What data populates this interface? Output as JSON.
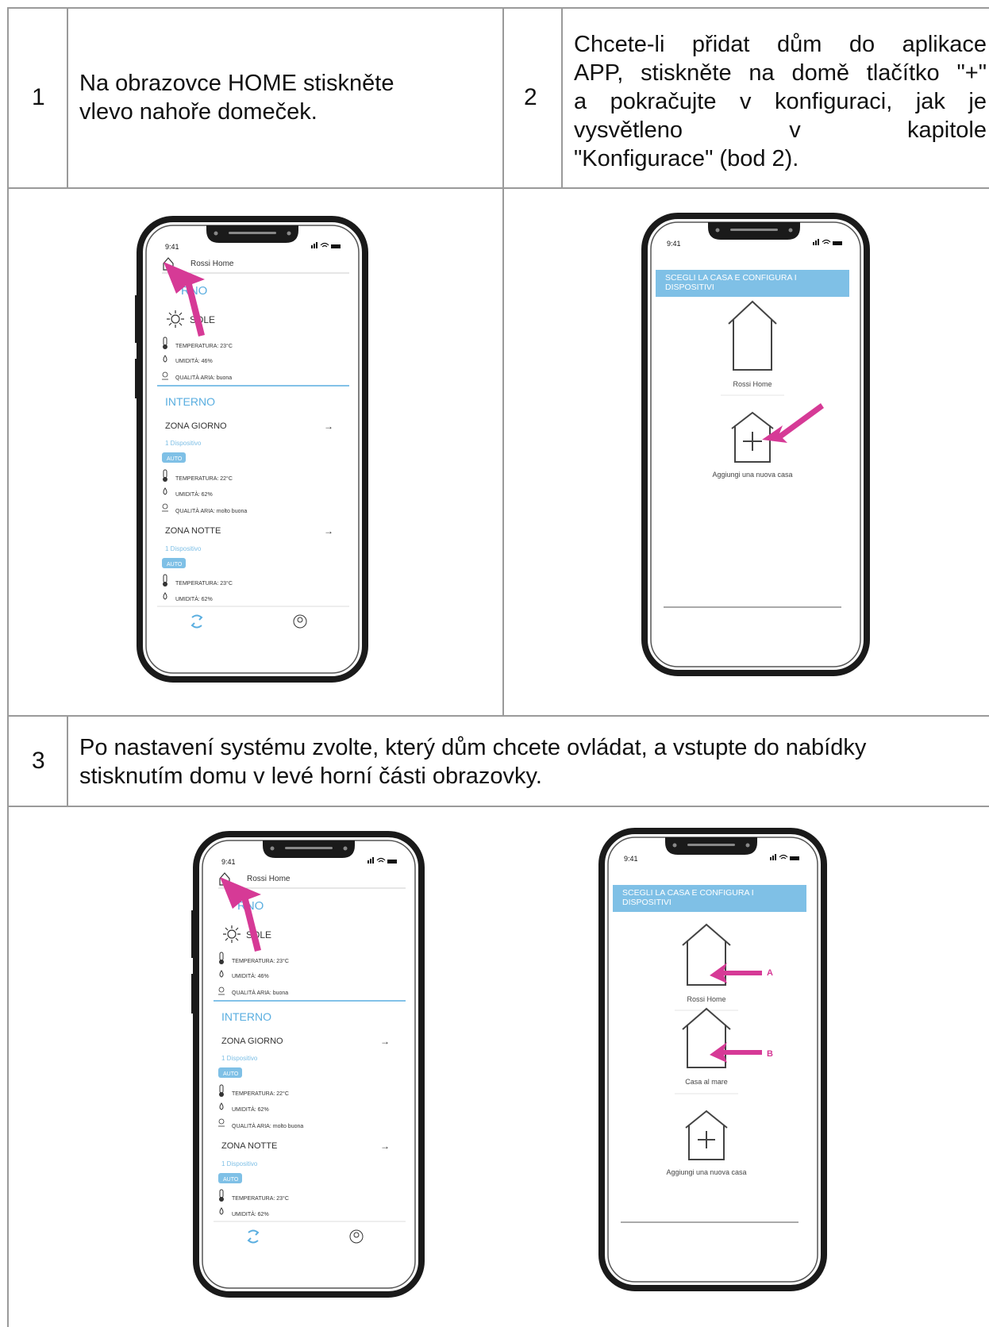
{
  "steps": [
    {
      "number": "1",
      "text_lines": [
        "Na obrazovce HOME stiskněte",
        "vlevo nahoře domeček."
      ]
    },
    {
      "number": "2",
      "text_lines": [
        "Chcete-li přidat dům do aplikace",
        "APP, stiskněte na domě tlačítko \"+\"",
        "a pokračujte v konfiguraci, jak je",
        "vysvětleno v kapitole",
        "\"Konfigurace\" (bod 2)."
      ]
    },
    {
      "number": "3",
      "text_lines": [
        "Po nastavení systému zvolte, který dům chcete ovládat, a vstupte do nabídky",
        "stisknutím domu v levé horní části obrazovky."
      ]
    }
  ],
  "home_screen": {
    "time": "9:41",
    "home_name": "Rossi Home",
    "external_section": "ESTERNO",
    "external_section_visible": "RNO",
    "weather": "SOLE",
    "ext_temp": "TEMPERATURA: 23°C",
    "ext_humidity": "UMIDITÀ: 46%",
    "ext_air": "QUALITÀ ARIA: buona",
    "internal_section": "INTERNO",
    "zone1": {
      "name": "ZONA GIORNO",
      "devices": "1 Dispositivo",
      "mode": "AUTO",
      "temp": "TEMPERATURA: 22°C",
      "humidity": "UMIDITÀ: 62%",
      "air": "QUALITÀ ARIA: molto buona"
    },
    "zone2": {
      "name": "ZONA NOTTE",
      "devices": "1 Dispositivo",
      "mode": "AUTO",
      "temp": "TEMPERATURA: 23°C",
      "humidity": "UMIDITÀ: 62%"
    }
  },
  "select_screen": {
    "time": "9:41",
    "banner_line1": "SCEGLI LA CASA E CONFIGURA I",
    "banner_line2": "DISPOSITIVI",
    "house1": "Rossi Home",
    "house2": "Casa al mare",
    "add_house": "Aggiungi una nuova casa",
    "label_a": "A",
    "label_b": "B"
  },
  "colors": {
    "accent": "#5aaee0",
    "banner": "#7fc0e6",
    "arrow": "#d63a96",
    "border": "#9a9a9a"
  },
  "icons": [
    "home-icon",
    "sun-icon",
    "thermometer-icon",
    "drop-icon",
    "air-quality-icon",
    "arrow-right-icon",
    "sync-icon",
    "profile-icon",
    "add-house-icon",
    "pointer-arrow-icon"
  ]
}
